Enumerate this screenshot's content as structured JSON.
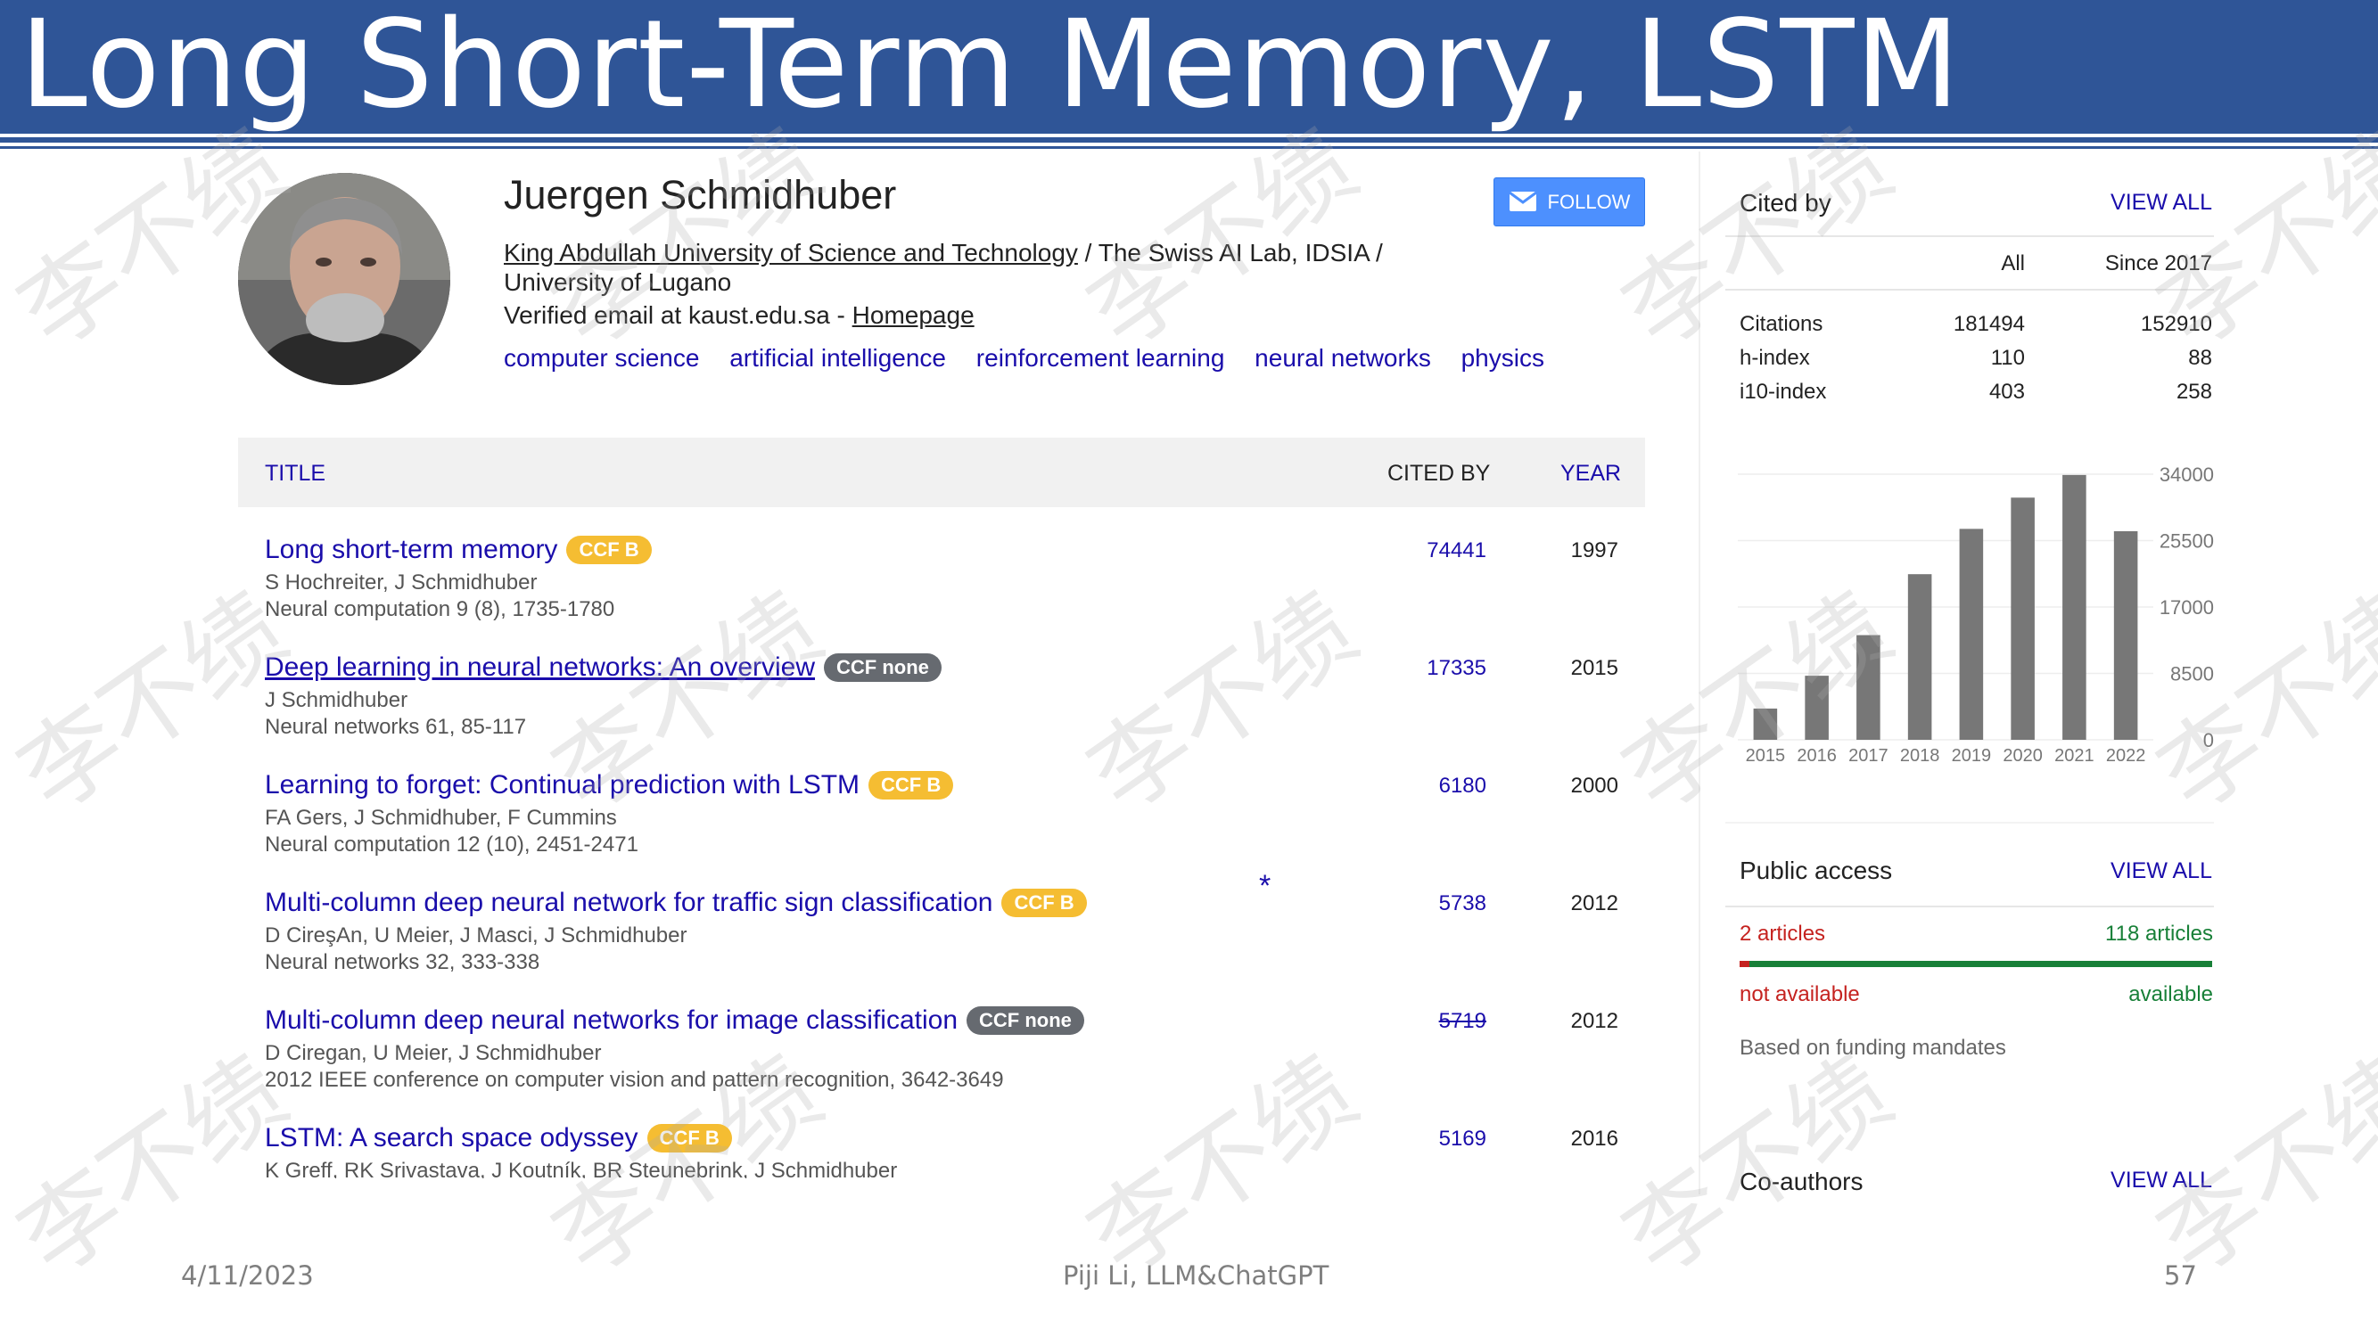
{
  "slide": {
    "title": "Long Short-Term Memory, LSTM",
    "footer_date": "4/11/2023",
    "footer_center": "Piji Li, LLM&ChatGPT",
    "footer_page": "57",
    "watermark": "李不绩"
  },
  "profile": {
    "name": "Juergen Schmidhuber",
    "affiliation_link": "King Abdullah University of Science and Technology",
    "affiliation_rest": " / The Swiss AI Lab, IDSIA / University of Lugano",
    "email_text": "Verified email at kaust.edu.sa - ",
    "homepage": "Homepage",
    "interests": [
      "computer science",
      "artificial intelligence",
      "reinforcement learning",
      "neural networks",
      "physics"
    ],
    "follow_label": "FOLLOW"
  },
  "table": {
    "col_title": "TITLE",
    "col_cited": "CITED BY",
    "col_year": "YEAR",
    "rows": [
      {
        "title": "Long short-term memory",
        "badge": "CCF B",
        "authors": "S Hochreiter, J Schmidhuber",
        "venue": "Neural computation 9 (8), 1735-1780",
        "cited": "74441",
        "year": "1997"
      },
      {
        "title": "Deep learning in neural networks: An overview",
        "badge": "CCF none",
        "authors": "J Schmidhuber",
        "venue": "Neural networks 61, 85-117",
        "cited": "17335",
        "year": "2015"
      },
      {
        "title": "Learning to forget: Continual prediction with LSTM",
        "badge": "CCF B",
        "authors": "FA Gers, J Schmidhuber, F Cummins",
        "venue": "Neural computation 12 (10), 2451-2471",
        "cited": "6180",
        "year": "2000"
      },
      {
        "title": "Multi-column deep neural network for traffic sign classification",
        "badge": "CCF B",
        "authors": "D CireşAn, U Meier, J Masci, J Schmidhuber",
        "venue": "Neural networks 32, 333-338",
        "cited": "5738",
        "year": "2012",
        "marker": "*"
      },
      {
        "title": "Multi-column deep neural networks for image classification",
        "badge": "CCF none",
        "authors": "D Ciregan, U Meier, J Schmidhuber",
        "venue": "2012 IEEE conference on computer vision and pattern recognition, 3642-3649",
        "cited": "5719",
        "year": "2012"
      },
      {
        "title": "LSTM: A search space odyssey",
        "badge": "CCF B",
        "authors": "K Greff, RK Srivastava, J Koutník, BR Steunebrink, J Schmidhuber",
        "venue": "",
        "cited": "5169",
        "year": "2016"
      }
    ]
  },
  "cited_by": {
    "title": "Cited by",
    "view_all": "VIEW ALL",
    "col_all": "All",
    "col_since": "Since 2017",
    "metrics": [
      {
        "label": "Citations",
        "all": "181494",
        "since": "152910"
      },
      {
        "label": "h-index",
        "all": "110",
        "since": "88"
      },
      {
        "label": "i10-index",
        "all": "403",
        "since": "258"
      }
    ]
  },
  "chart_data": {
    "type": "bar",
    "categories": [
      "2015",
      "2016",
      "2017",
      "2018",
      "2019",
      "2020",
      "2021",
      "2022"
    ],
    "values": [
      4000,
      8200,
      13400,
      21200,
      27000,
      31000,
      33900,
      26700
    ],
    "yticks": [
      0,
      8500,
      17000,
      25500,
      34000
    ],
    "ylim": [
      0,
      34000
    ],
    "bar_color": "#777777",
    "grid": true
  },
  "public_access": {
    "title": "Public access",
    "view_all": "VIEW ALL",
    "not_available_count": "2 articles",
    "available_count": "118 articles",
    "not_available_label": "not available",
    "available_label": "available",
    "note": "Based on funding mandates"
  },
  "coauthors": {
    "title": "Co-authors",
    "view_all": "VIEW ALL"
  }
}
